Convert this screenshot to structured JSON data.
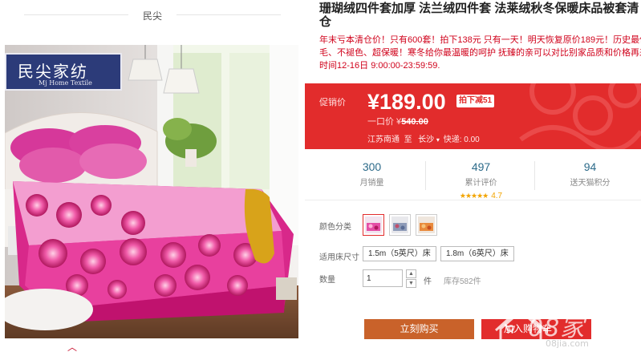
{
  "shop": {
    "name": "民尖"
  },
  "brand": {
    "name_cn": "民尖家纺",
    "name_en": "Mj Home Textile"
  },
  "product": {
    "title_line1": "珊瑚绒四件套加厚 法兰绒四件套 法莱绒秋冬保暖床品被套清",
    "title_line2": "仓",
    "promo_line1": "年末亏本清仓价！只有600套！拍下138元 只有一天！明天恢复原价189元！历史最低！不掉",
    "promo_line2": "毛、不褪色、超保暖！寒冬给你最温暖的呵护 抚臻的亲可以对比别家品质和价格再来！活动",
    "promo_line3": "时间12-16日 9:00:00-23:59:59."
  },
  "price": {
    "label": "促销价",
    "current": "¥189.00",
    "tag": "拍下减51",
    "orig_label": "一口价 ¥",
    "orig_value": "540.00",
    "ship_from": "江苏南通",
    "ship_to_word": "至",
    "ship_dest": "长沙",
    "ship_fee": "快递: 0.00"
  },
  "stats": {
    "sales": {
      "value": "300",
      "label": "月销量"
    },
    "reviews": {
      "value": "497",
      "label": "累计评价",
      "stars": "★★★★★",
      "rating": "4.7"
    },
    "points": {
      "value": "94",
      "label": "送天猫积分"
    }
  },
  "options": {
    "color_label": "颜色分类",
    "size_label": "适用床尺寸",
    "sizes": [
      "1.5m（5英尺）床",
      "1.8m（6英尺）床"
    ],
    "qty_label": "数量",
    "qty_value": "1",
    "qty_unit": "件",
    "stock": "库存582件"
  },
  "actions": {
    "buy": "立刻购买",
    "cart": "加入购物车"
  },
  "watermark": {
    "text": "08家",
    "sub": "08jia.com"
  },
  "colors": {
    "accent": "#e22c2c",
    "buy": "#c9622a",
    "brand": "#2c3b79"
  }
}
